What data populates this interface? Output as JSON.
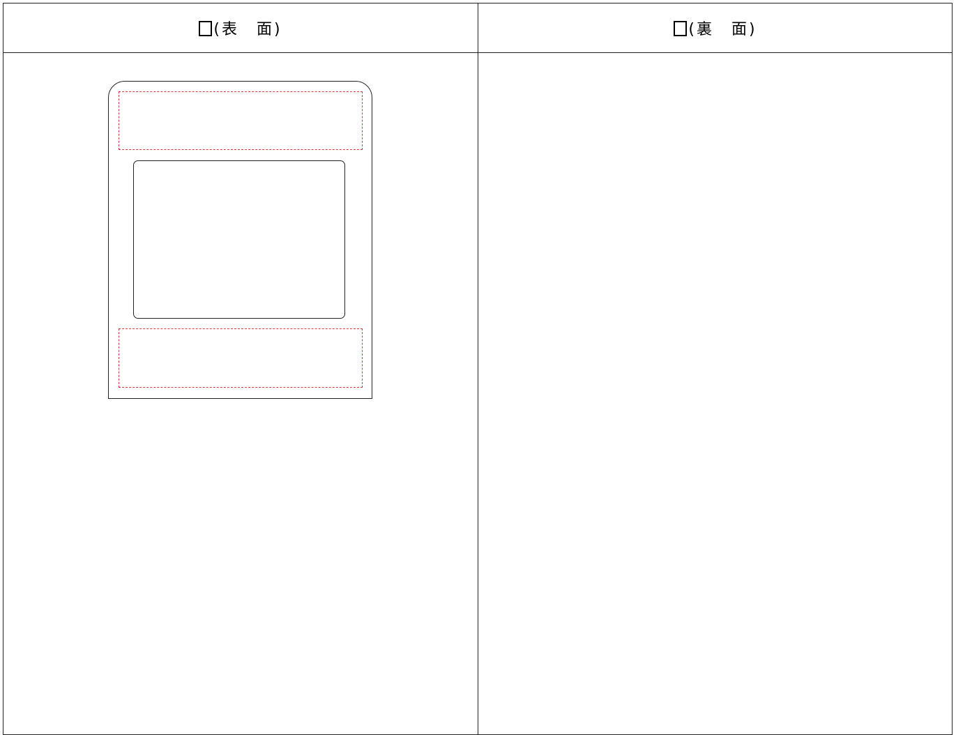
{
  "header": {
    "front_label": "(表　面)",
    "back_label": "(裏　面)"
  },
  "icons": {
    "front_checkbox": "empty-checkbox",
    "back_checkbox": "empty-checkbox"
  },
  "colors": {
    "dashed_guide": "#d23a3a",
    "lines": "#222222"
  }
}
